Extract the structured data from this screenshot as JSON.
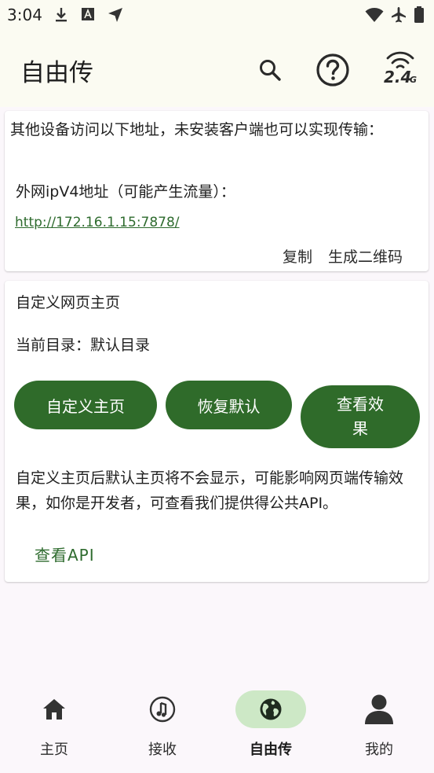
{
  "status_bar": {
    "time": "3:04",
    "left_icons": [
      "download-icon",
      "font-a-icon",
      "location-arrow-icon"
    ],
    "right_icons": [
      "wifi-icon",
      "airplane-icon",
      "battery-icon"
    ]
  },
  "app_bar": {
    "title": "自由传",
    "actions": [
      "search-icon",
      "help-icon",
      "wifi-2.4g-icon"
    ],
    "wifi_band": "2.4",
    "wifi_band_unit": "G"
  },
  "access_card": {
    "description": "其他设备访问以下地址，未安装客户端也可以实现传输：",
    "address_label": "外网ipV4地址（可能产生流量）：",
    "url": "http://172.16.1.15:7878/",
    "copy_label": "复制",
    "qr_label": "生成二维码"
  },
  "homepage_card": {
    "title": "自定义网页主页",
    "current_dir": "当前目录：默认目录",
    "buttons": {
      "custom": "自定义主页",
      "restore": "恢复默认",
      "preview_line1": "查看效",
      "preview_line2": "果"
    },
    "note": "自定义主页后默认主页将不会显示，可能影响网页端传输效果，如你是开发者，可查看我们提供得公共API。",
    "api_link": "查看API"
  },
  "bottom_nav": {
    "items": [
      {
        "label": "主页",
        "icon": "home-icon",
        "active": false
      },
      {
        "label": "接收",
        "icon": "music-note-icon",
        "active": false
      },
      {
        "label": "自由传",
        "icon": "globe-icon",
        "active": true
      },
      {
        "label": "我的",
        "icon": "person-icon",
        "active": false
      }
    ]
  },
  "colors": {
    "accent": "#2f6b2a",
    "nav_active_bg": "#cde8c6",
    "background": "#fbf7fb"
  }
}
